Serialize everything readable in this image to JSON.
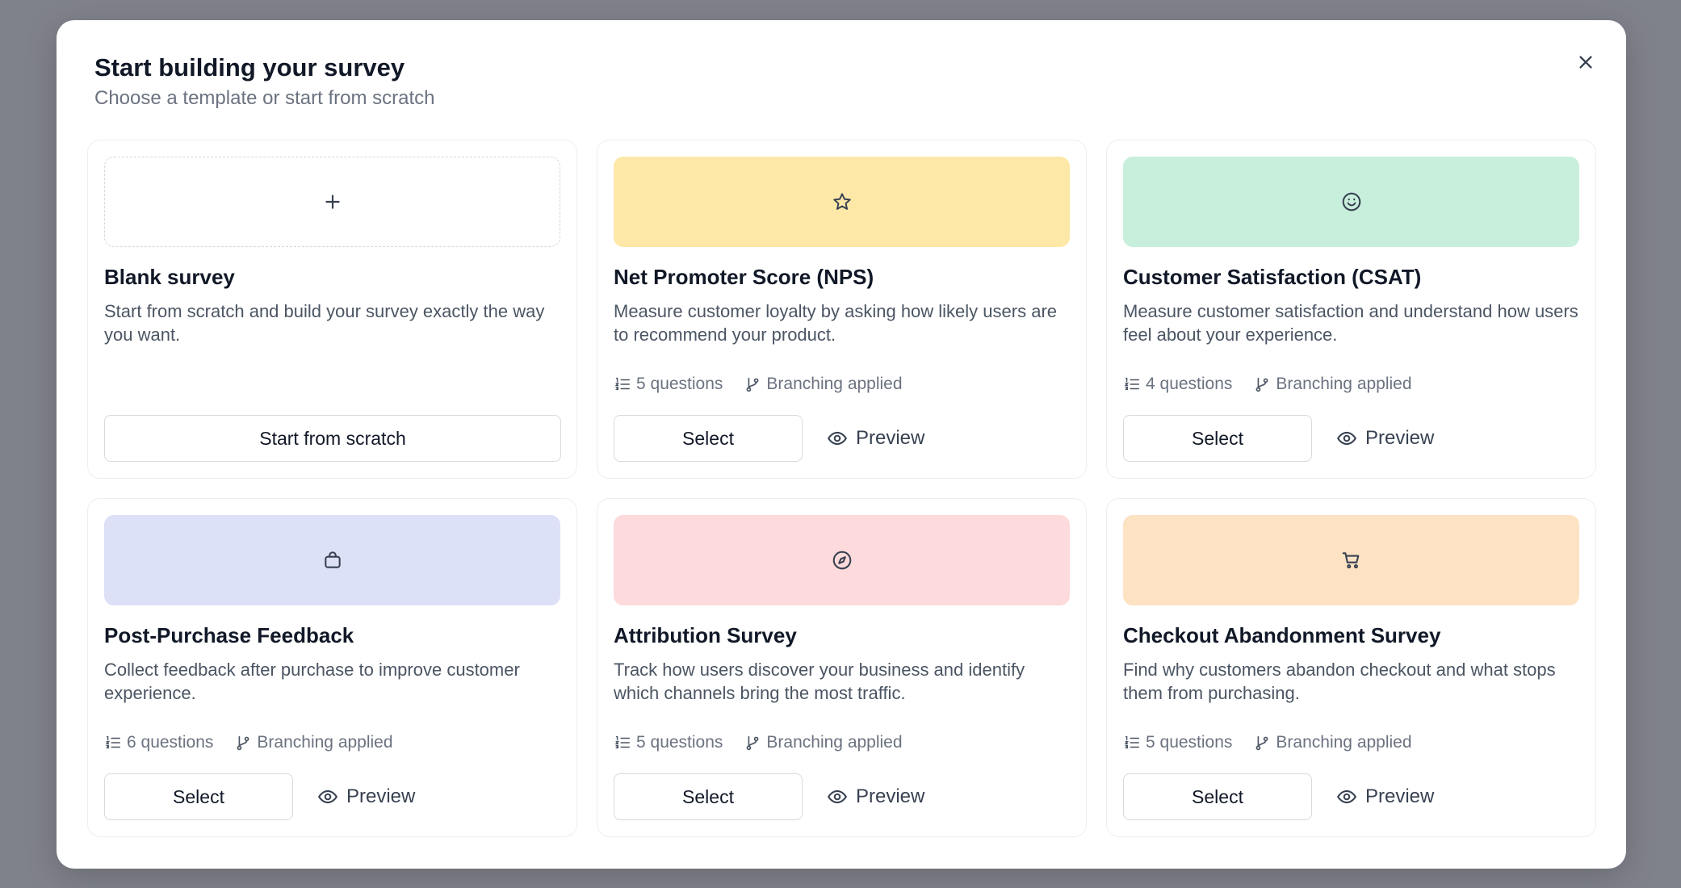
{
  "modal": {
    "title": "Start building your survey",
    "subtitle": "Choose a template or start from scratch"
  },
  "colors": {
    "nps": "#fde8a8",
    "csat": "#c8efdc",
    "post_purchase": "#dde1f8",
    "attribution": "#fddadb",
    "checkout": "#fde2c3",
    "overlay": "#80828b"
  },
  "cards": {
    "blank": {
      "icon": "plus-icon",
      "title": "Blank survey",
      "description": "Start from scratch and build your survey exactly the way you want.",
      "button_label": "Start from scratch"
    },
    "nps": {
      "icon": "star-icon",
      "title": "Net Promoter Score (NPS)",
      "description": "Measure customer loyalty by asking how likely users are to recommend your product.",
      "questions": "5 questions",
      "branching": "Branching applied",
      "select_label": "Select",
      "preview_label": "Preview"
    },
    "csat": {
      "icon": "smile-icon",
      "title": "Customer Satisfaction (CSAT)",
      "description": "Measure customer satisfaction and understand how users feel about your experience.",
      "questions": "4 questions",
      "branching": "Branching applied",
      "select_label": "Select",
      "preview_label": "Preview"
    },
    "post_purchase": {
      "icon": "shopping-bag-icon",
      "title": "Post-Purchase Feedback",
      "description": "Collect feedback after purchase to improve customer experience.",
      "questions": "6 questions",
      "branching": "Branching applied",
      "select_label": "Select",
      "preview_label": "Preview"
    },
    "attribution": {
      "icon": "compass-icon",
      "title": "Attribution Survey",
      "description": "Track how users discover your business and identify which channels bring the most traffic.",
      "questions": "5 questions",
      "branching": "Branching applied",
      "select_label": "Select",
      "preview_label": "Preview"
    },
    "checkout": {
      "icon": "shopping-cart-icon",
      "title": "Checkout Abandonment Survey",
      "description": "Find why customers abandon checkout and what stops them from purchasing.",
      "questions": "5 questions",
      "branching": "Branching applied",
      "select_label": "Select",
      "preview_label": "Preview"
    }
  }
}
